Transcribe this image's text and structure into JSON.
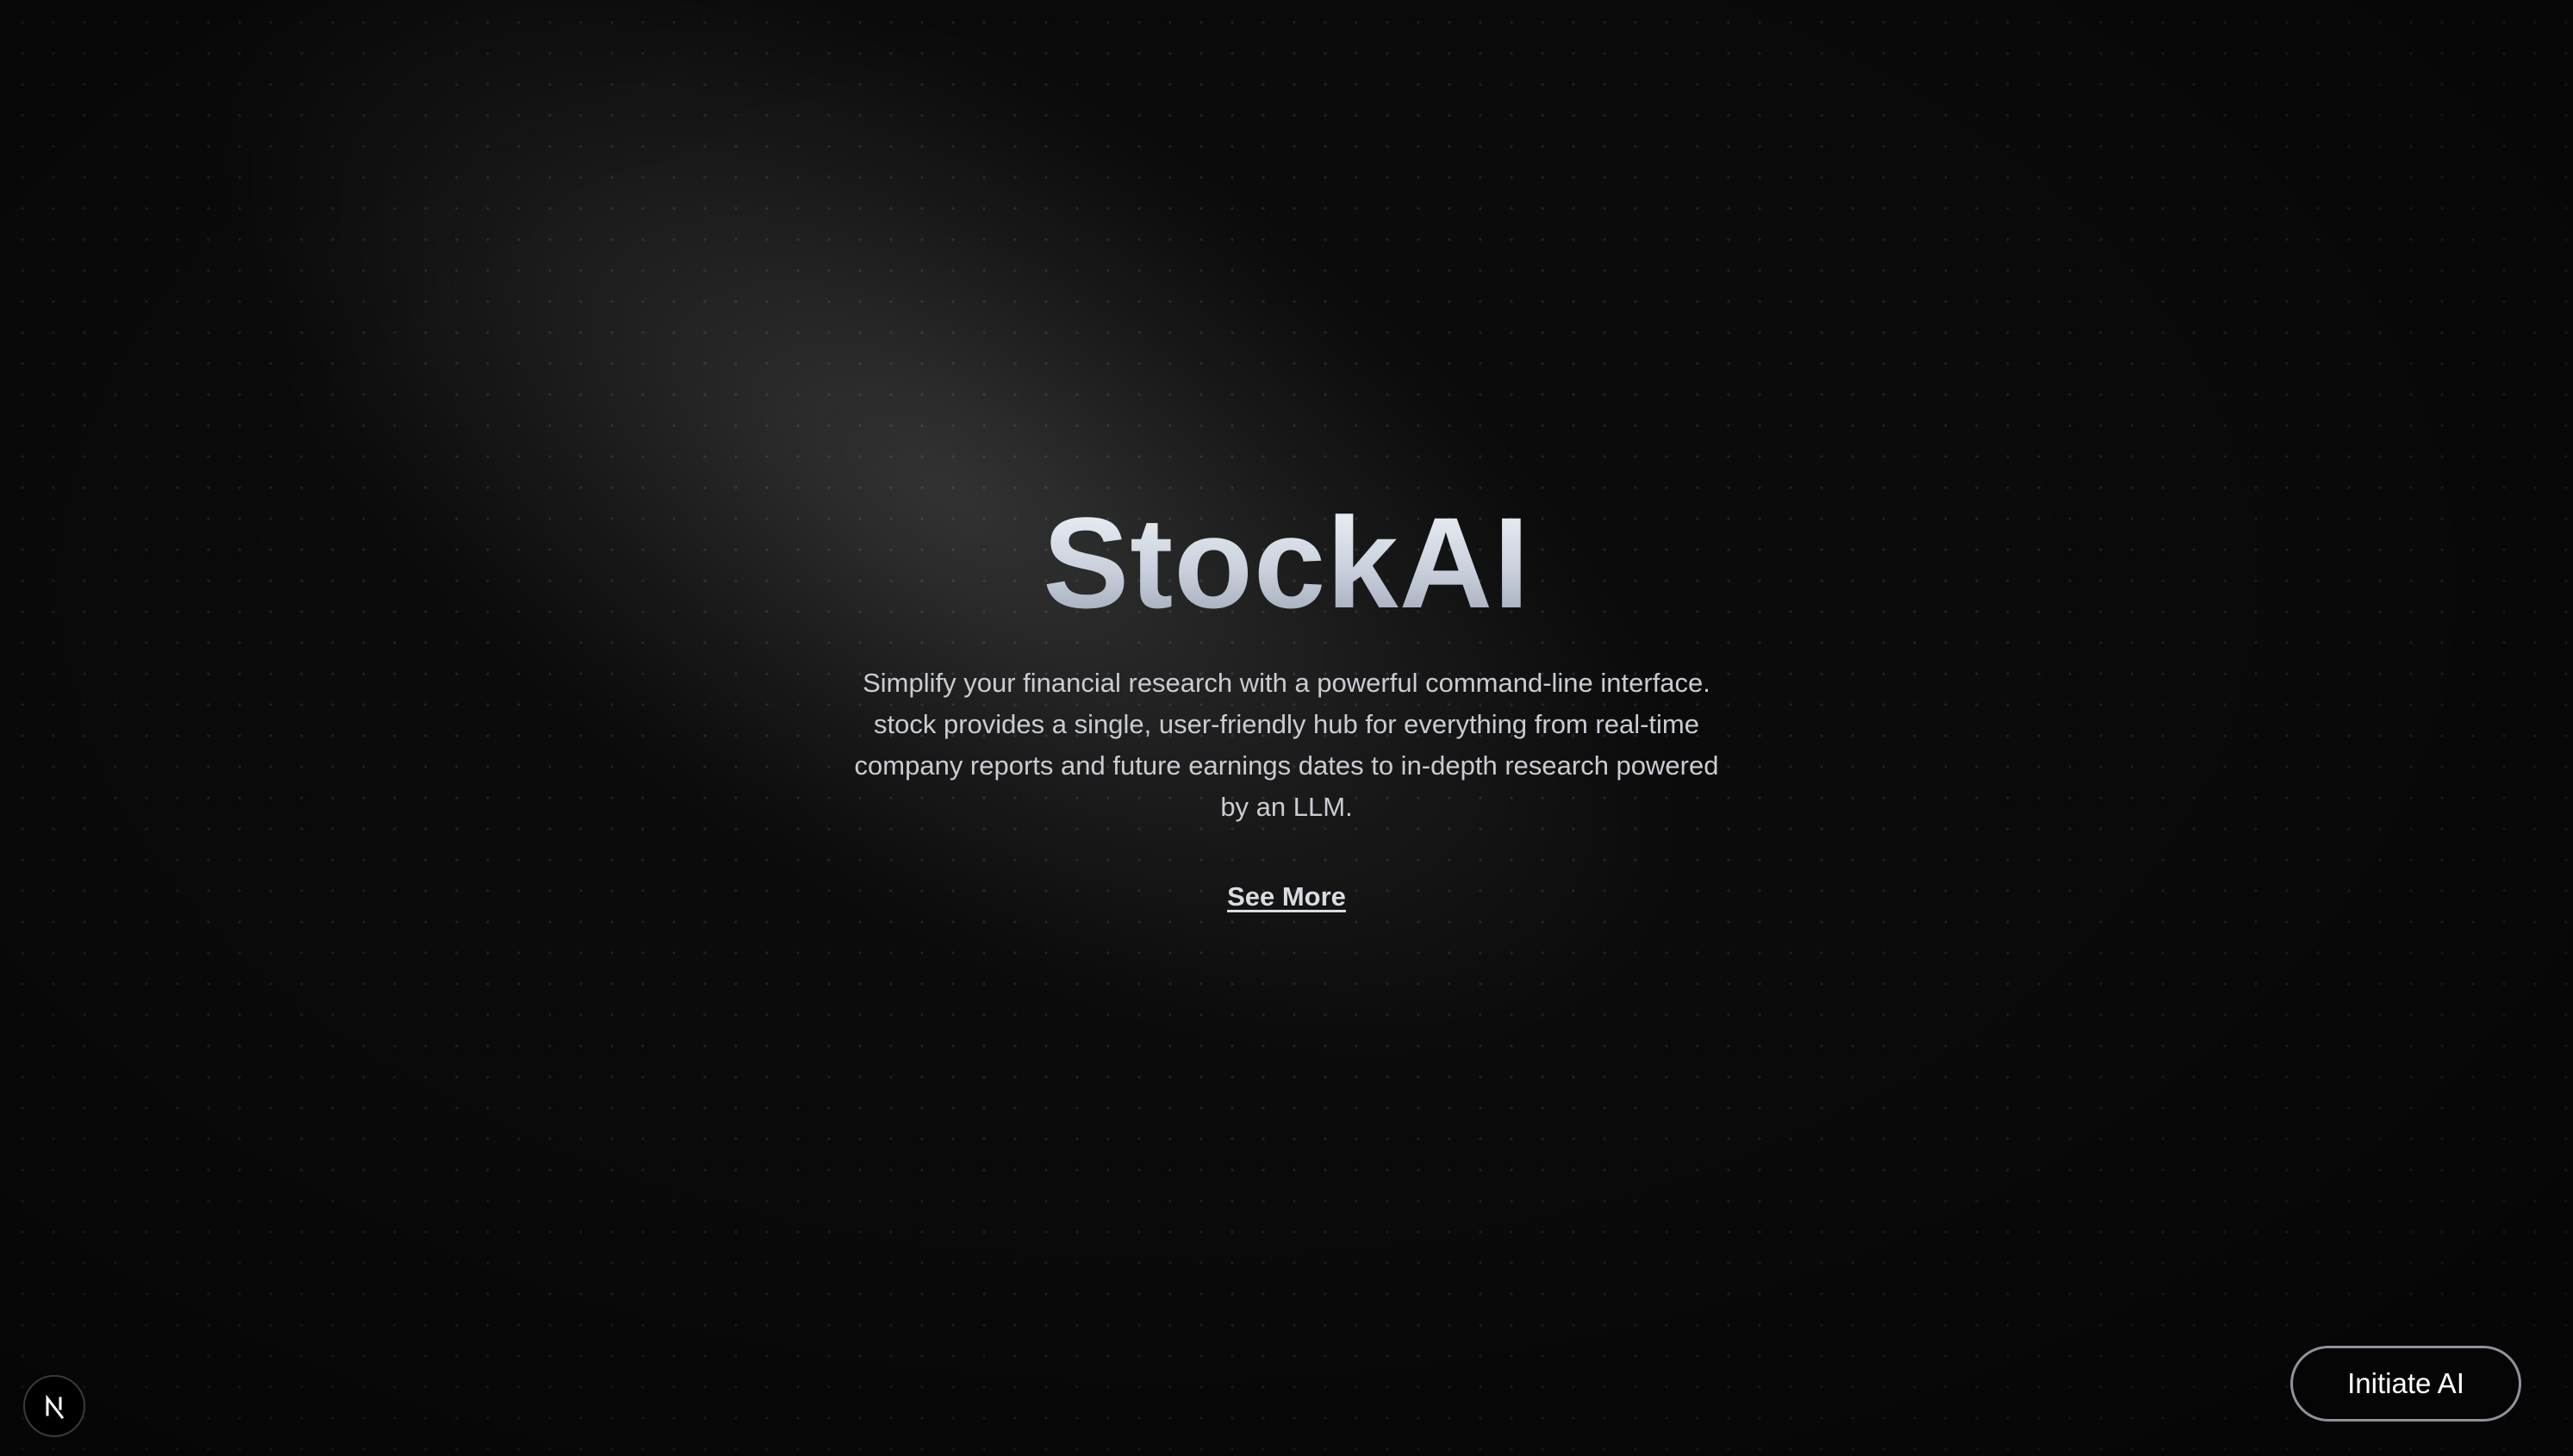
{
  "hero": {
    "title": "StockAI",
    "description": "Simplify your financial research with a powerful command-line interface. stock provides a single, user-friendly hub for everything from real-time company reports and future earnings dates to in-depth research powered by an LLM.",
    "see_more_label": "See More"
  },
  "actions": {
    "initiate_label": "Initiate AI"
  },
  "badge": {
    "icon": "nextjs-logo-icon"
  },
  "colors": {
    "background": "#0b0b0b",
    "title_gradient_top": "#f1f4fa",
    "title_gradient_bottom": "#9aa3b2",
    "text": "#c9ccd2",
    "button_border": "#8e929a"
  }
}
